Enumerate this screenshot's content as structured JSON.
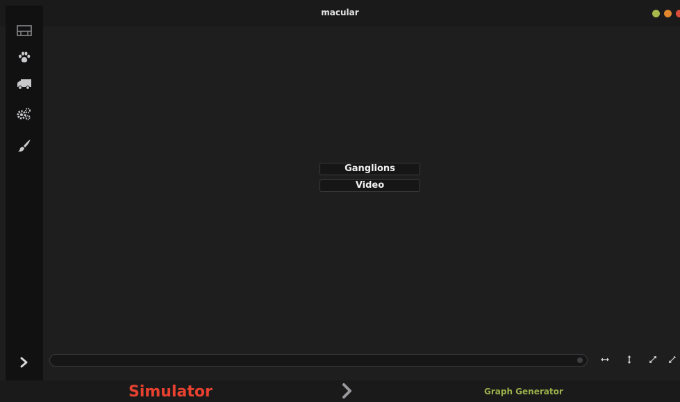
{
  "window": {
    "title": "macular",
    "controls": [
      {
        "name": "minimize",
        "color": "#a7b84c"
      },
      {
        "name": "maximize",
        "color": "#e0862f"
      },
      {
        "name": "close",
        "color": "#d94c3a"
      }
    ]
  },
  "sidebar": {
    "items": [
      {
        "icon": "film-icon"
      },
      {
        "icon": "paw-icon"
      },
      {
        "icon": "truck-icon"
      },
      {
        "icon": "gears-icon"
      },
      {
        "icon": "brush-icon"
      }
    ],
    "toggle_icon": "chevron-right-icon"
  },
  "main": {
    "buttons": [
      {
        "label": "Ganglions"
      },
      {
        "label": "Video"
      }
    ]
  },
  "controls": {
    "icons": [
      "arrows-horizontal-icon",
      "arrows-vertical-icon",
      "expand-icon",
      "compress-icon"
    ]
  },
  "footer": {
    "left_label": "Simulator",
    "right_label": "Graph Generator",
    "left_color": "#e8412f",
    "right_color": "#9bb04a"
  }
}
